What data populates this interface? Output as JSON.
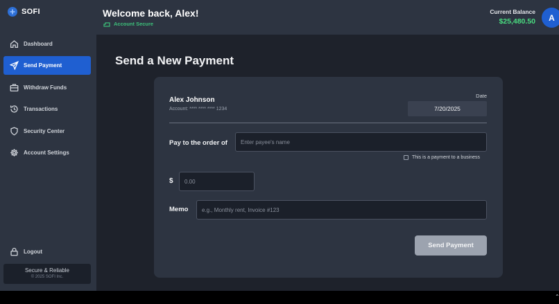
{
  "brand": {
    "name": "SOFI"
  },
  "sidebar": {
    "items": [
      {
        "label": "Dashboard",
        "icon": "home-icon",
        "active": false
      },
      {
        "label": "Send Payment",
        "icon": "send-icon",
        "active": true
      },
      {
        "label": "Withdraw Funds",
        "icon": "briefcase-icon",
        "active": false
      },
      {
        "label": "Transactions",
        "icon": "history-icon",
        "active": false
      },
      {
        "label": "Security Center",
        "icon": "shield-icon",
        "active": false
      },
      {
        "label": "Account Settings",
        "icon": "gear-icon",
        "active": false
      }
    ],
    "logout_label": "Logout",
    "footer": {
      "title": "Secure & Reliable",
      "copyright": "© 2025 SOFI Inc."
    }
  },
  "header": {
    "welcome": "Welcome back, Alex!",
    "status": "Account Secure",
    "balance_label": "Current Balance",
    "balance_value": "$25,480.50",
    "avatar_initial": "A"
  },
  "page": {
    "title": "Send a New Payment"
  },
  "form": {
    "payer_name": "Alex Johnson",
    "payer_account": "Account: **** **** **** 1234",
    "date_label": "Date",
    "date_value": "7/20/2025",
    "pay_to_label": "Pay to the order of",
    "payee_placeholder": "Enter payee's name",
    "business_label": "This is a payment to a business",
    "dollar_sign": "$",
    "amount_placeholder": "0.00",
    "memo_label": "Memo",
    "memo_placeholder": "e.g., Monthly rent, Invoice #123",
    "submit_label": "Send Payment"
  },
  "colors": {
    "accent": "#1f5fd1",
    "success": "#4ade80",
    "sidebar_bg": "#2d3441",
    "main_bg": "#1e222b"
  }
}
